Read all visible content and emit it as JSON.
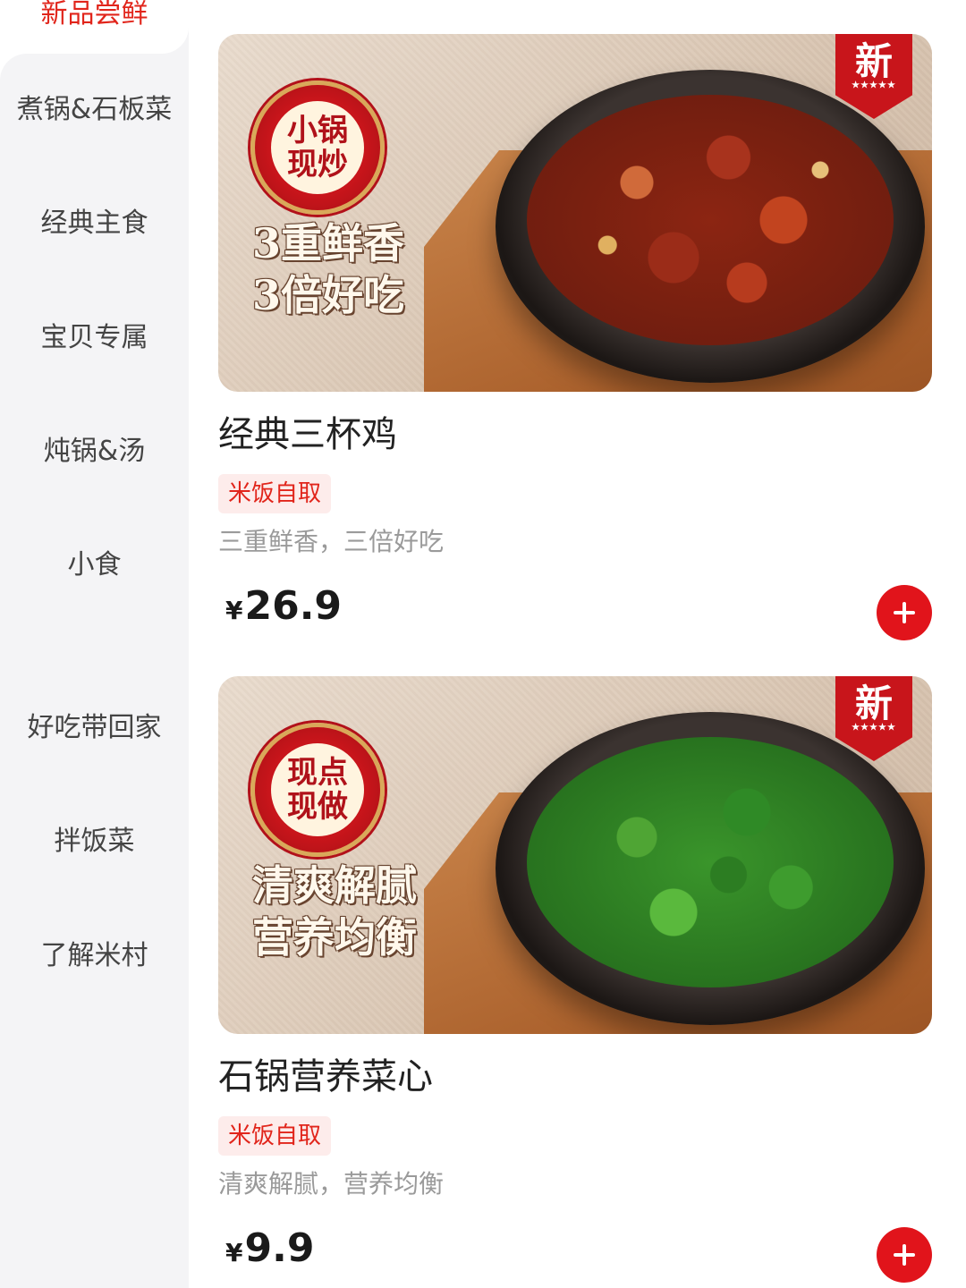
{
  "sidebar": {
    "active_label": "新品尝鲜",
    "items": [
      {
        "label": "煮锅&石板菜"
      },
      {
        "label": "经典主食"
      },
      {
        "label": "宝贝专属"
      },
      {
        "label": "炖锅&汤"
      },
      {
        "label": "小食"
      },
      {
        "label": "好吃带回家"
      },
      {
        "label": "拌饭菜"
      },
      {
        "label": "了解米村"
      }
    ]
  },
  "products": [
    {
      "image": {
        "badge": "小锅\n现炒",
        "slogan": "3重鲜香\n3倍好吃",
        "new_tag": "新",
        "stars": "★★★★★"
      },
      "name": "经典三杯鸡",
      "tag": "米饭自取",
      "description": "三重鲜香，三倍好吃",
      "currency": "¥",
      "price": "26.9",
      "add_icon": "plus-icon"
    },
    {
      "image": {
        "badge": "现点\n现做",
        "slogan": "清爽解腻\n营养均衡",
        "new_tag": "新",
        "stars": "★★★★★"
      },
      "name": "石锅营养菜心",
      "tag": "米饭自取",
      "description": "清爽解腻，营养均衡",
      "currency": "¥",
      "price": "9.9",
      "add_icon": "plus-icon"
    }
  ],
  "colors": {
    "accent": "#e1251b",
    "sidebar_bg": "#f4f4f6",
    "tag_bg": "#fdeceb"
  }
}
